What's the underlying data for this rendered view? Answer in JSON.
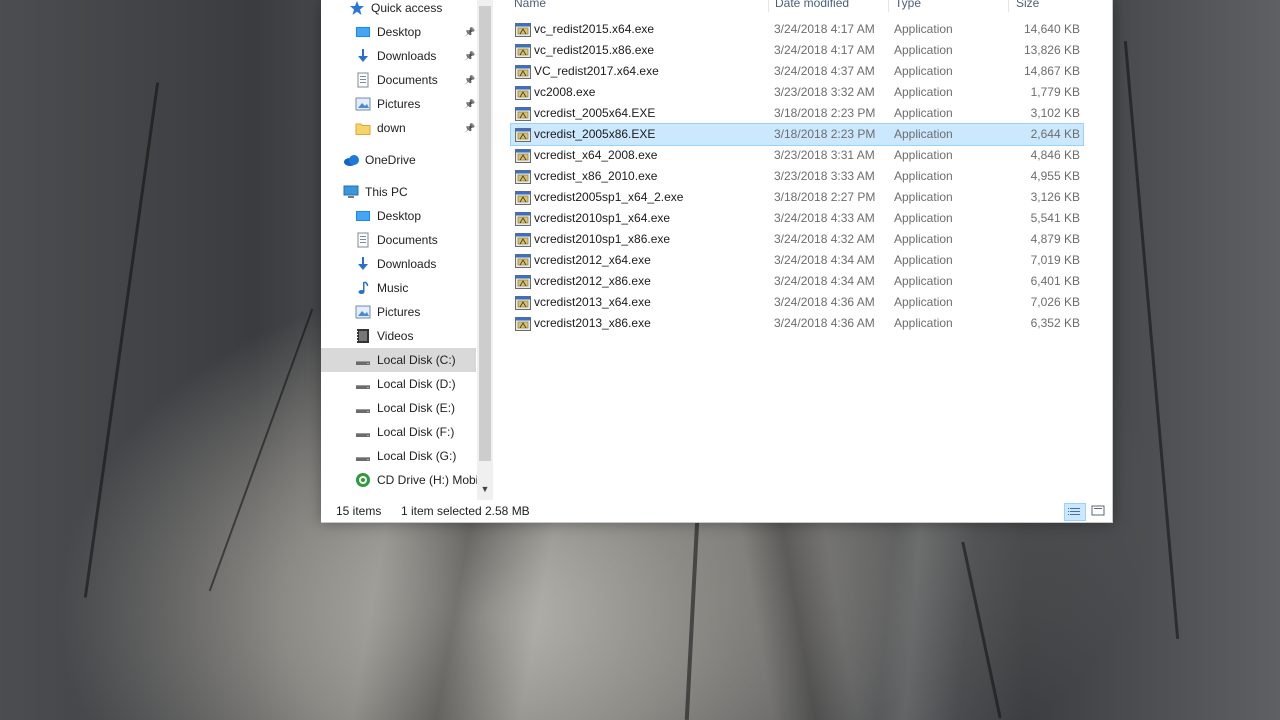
{
  "nav": {
    "items": [
      {
        "label": "Quick access",
        "icon": "star-icon",
        "pinned": false
      },
      {
        "label": "Desktop",
        "icon": "desktop-folder-icon",
        "pinned": true
      },
      {
        "label": "Downloads",
        "icon": "downloads-folder-icon",
        "pinned": true
      },
      {
        "label": "Documents",
        "icon": "documents-folder-icon",
        "pinned": true
      },
      {
        "label": "Pictures",
        "icon": "pictures-folder-icon",
        "pinned": true
      },
      {
        "label": "down",
        "icon": "folder-icon",
        "pinned": true
      },
      {
        "label": "OneDrive",
        "icon": "cloud-icon",
        "pinned": false
      },
      {
        "label": "This PC",
        "icon": "computer-icon",
        "pinned": false
      },
      {
        "label": "Desktop",
        "icon": "desktop-folder-icon",
        "pinned": false
      },
      {
        "label": "Documents",
        "icon": "documents-folder-icon",
        "pinned": false
      },
      {
        "label": "Downloads",
        "icon": "downloads-folder-icon",
        "pinned": false
      },
      {
        "label": "Music",
        "icon": "music-icon",
        "pinned": false
      },
      {
        "label": "Pictures",
        "icon": "pictures-folder-icon",
        "pinned": false
      },
      {
        "label": "Videos",
        "icon": "videos-folder-icon",
        "pinned": false
      },
      {
        "label": "Local Disk (C:)",
        "icon": "drive-icon",
        "pinned": false
      },
      {
        "label": "Local Disk (D:)",
        "icon": "drive-icon",
        "pinned": false
      },
      {
        "label": "Local Disk (E:)",
        "icon": "drive-icon",
        "pinned": false
      },
      {
        "label": "Local Disk (F:)",
        "icon": "drive-icon",
        "pinned": false
      },
      {
        "label": "Local Disk (G:)",
        "icon": "drive-icon",
        "pinned": false
      },
      {
        "label": "CD Drive (H:) Mobi",
        "icon": "cd-drive-icon",
        "pinned": false
      }
    ]
  },
  "columns": {
    "name": "Name",
    "date": "Date modified",
    "type": "Type",
    "size": "Size"
  },
  "files": [
    {
      "name": "vc_redist2015.x64.exe",
      "date": "3/24/2018 4:17 AM",
      "type": "Application",
      "size": "14,640 KB"
    },
    {
      "name": "vc_redist2015.x86.exe",
      "date": "3/24/2018 4:17 AM",
      "type": "Application",
      "size": "13,826 KB"
    },
    {
      "name": "VC_redist2017.x64.exe",
      "date": "3/24/2018 4:37 AM",
      "type": "Application",
      "size": "14,867 KB"
    },
    {
      "name": "vc2008.exe",
      "date": "3/23/2018 3:32 AM",
      "type": "Application",
      "size": "1,779 KB"
    },
    {
      "name": "vcredist_2005x64.EXE",
      "date": "3/18/2018 2:23 PM",
      "type": "Application",
      "size": "3,102 KB"
    },
    {
      "name": "vcredist_2005x86.EXE",
      "date": "3/18/2018 2:23 PM",
      "type": "Application",
      "size": "2,644 KB"
    },
    {
      "name": "vcredist_x64_2008.exe",
      "date": "3/23/2018 3:31 AM",
      "type": "Application",
      "size": "4,846 KB"
    },
    {
      "name": "vcredist_x86_2010.exe",
      "date": "3/23/2018 3:33 AM",
      "type": "Application",
      "size": "4,955 KB"
    },
    {
      "name": "vcredist2005sp1_x64_2.exe",
      "date": "3/18/2018 2:27 PM",
      "type": "Application",
      "size": "3,126 KB"
    },
    {
      "name": "vcredist2010sp1_x64.exe",
      "date": "3/24/2018 4:33 AM",
      "type": "Application",
      "size": "5,541 KB"
    },
    {
      "name": "vcredist2010sp1_x86.exe",
      "date": "3/24/2018 4:32 AM",
      "type": "Application",
      "size": "4,879 KB"
    },
    {
      "name": "vcredist2012_x64.exe",
      "date": "3/24/2018 4:34 AM",
      "type": "Application",
      "size": "7,019 KB"
    },
    {
      "name": "vcredist2012_x86.exe",
      "date": "3/24/2018 4:34 AM",
      "type": "Application",
      "size": "6,401 KB"
    },
    {
      "name": "vcredist2013_x64.exe",
      "date": "3/24/2018 4:36 AM",
      "type": "Application",
      "size": "7,026 KB"
    },
    {
      "name": "vcredist2013_x86.exe",
      "date": "3/24/2018 4:36 AM",
      "type": "Application",
      "size": "6,352 KB"
    }
  ],
  "selected_index": 5,
  "status": {
    "item_count": "15 items",
    "selection": "1 item selected",
    "selection_size": "2.58 MB"
  },
  "colors": {
    "selection_bg": "#cce8ff",
    "selection_border": "#99d1ff",
    "nav_selected_bg": "#d9d9d9"
  }
}
